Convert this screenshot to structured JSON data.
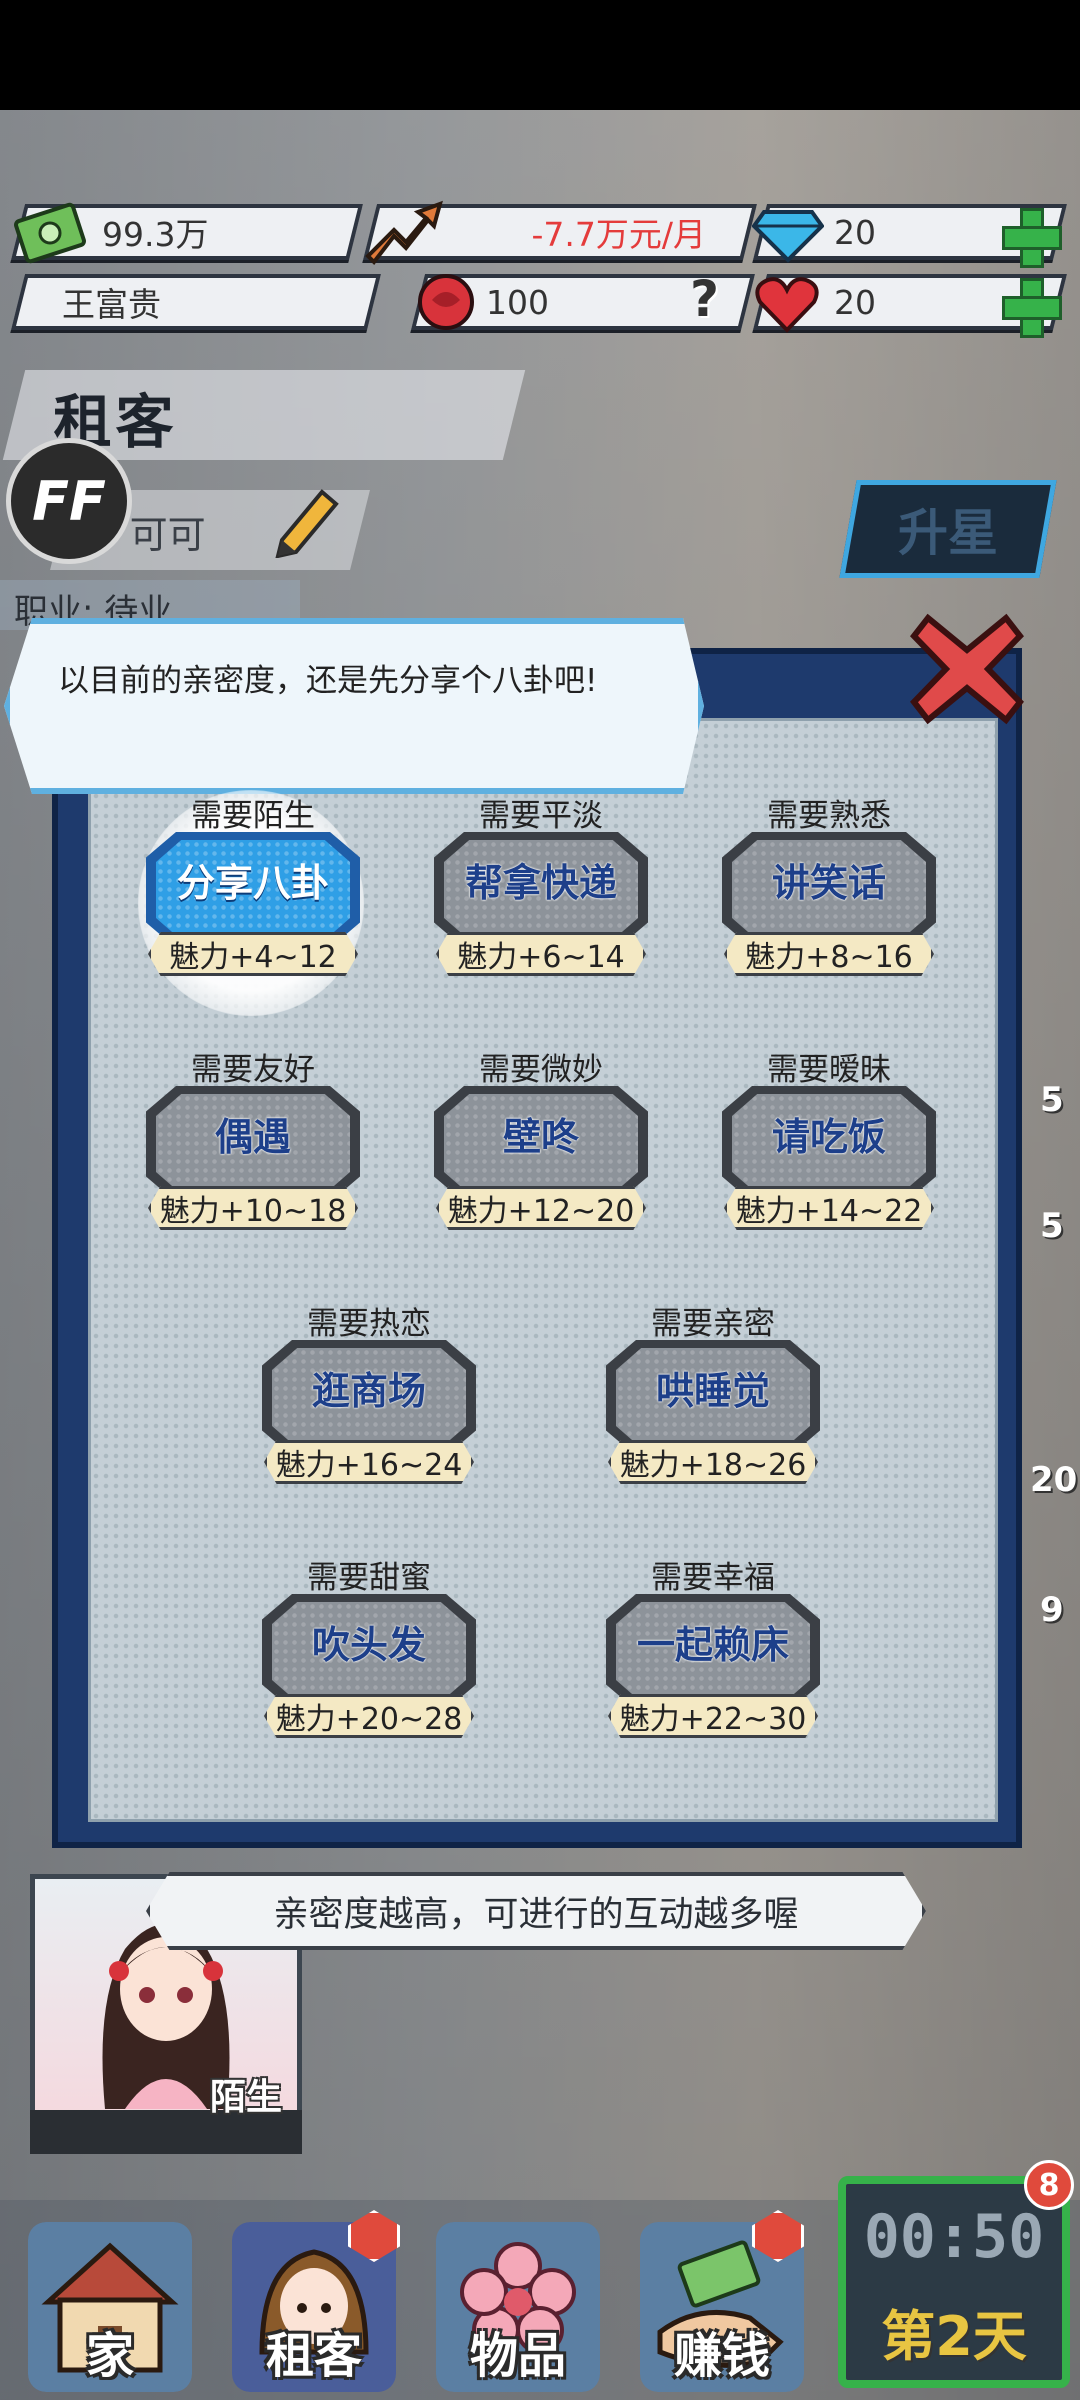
{
  "resources": {
    "money": "99.3万",
    "monthly_change": "-7.7万元/月",
    "diamonds": "20",
    "player_name": "王富贵",
    "fame": "100",
    "hearts": "20"
  },
  "section": {
    "title": "租客",
    "tenant_name": "可可",
    "upgrade_label": "升星",
    "job_label": "职业: 待业"
  },
  "badge": {
    "ff": "FF"
  },
  "dialog": {
    "speech": "以目前的亲密度，还是先分享个八卦吧!"
  },
  "actions": [
    {
      "requirement": "需要陌生",
      "label": "分享八卦",
      "stat": "魅力+4~12",
      "active": true
    },
    {
      "requirement": "需要平淡",
      "label": "帮拿快递",
      "stat": "魅力+6~14"
    },
    {
      "requirement": "需要熟悉",
      "label": "讲笑话",
      "stat": "魅力+8~16"
    },
    {
      "requirement": "需要友好",
      "label": "偶遇",
      "stat": "魅力+10~18"
    },
    {
      "requirement": "需要微妙",
      "label": "壁咚",
      "stat": "魅力+12~20"
    },
    {
      "requirement": "需要暧昧",
      "label": "请吃饭",
      "stat": "魅力+14~22"
    },
    {
      "requirement": "需要热恋",
      "label": "逛商场",
      "stat": "魅力+16~24"
    },
    {
      "requirement": "需要亲密",
      "label": "哄睡觉",
      "stat": "魅力+18~26"
    },
    {
      "requirement": "需要甜蜜",
      "label": "吹头发",
      "stat": "魅力+20~28"
    },
    {
      "requirement": "需要幸福",
      "label": "一起赖床",
      "stat": "魅力+22~30"
    }
  ],
  "hint": "亲密度越高，可进行的互动越多喔",
  "portrait": {
    "relation_tag": "陌生"
  },
  "nav": {
    "items": [
      {
        "label": "家",
        "icon": "house-icon"
      },
      {
        "label": "租客",
        "icon": "tenant-avatar-icon"
      },
      {
        "label": "物品",
        "icon": "flower-icon"
      },
      {
        "label": "赚钱",
        "icon": "money-hand-icon"
      }
    ]
  },
  "clock": {
    "time": "00:50",
    "day": "第2天",
    "badge": "8"
  },
  "colors": {
    "accent_blue": "#2f9fe6",
    "frame_navy": "#1e3a6d",
    "plus_green": "#36b24a",
    "alert_red": "#e04a3c"
  }
}
